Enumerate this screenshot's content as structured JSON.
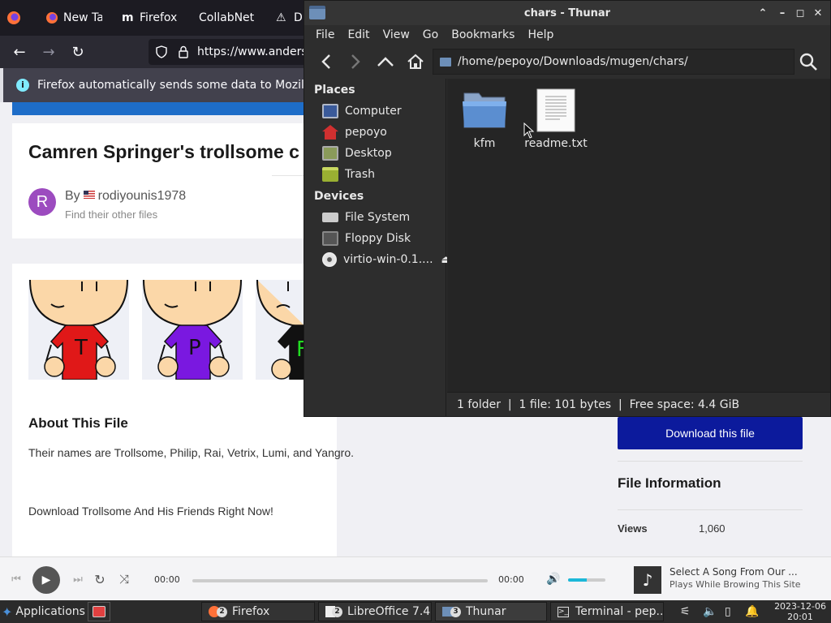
{
  "firefox": {
    "tabs": [
      {
        "label": "New Ta",
        "icon": "firefox-logo-icon"
      },
      {
        "label": "Firefox",
        "icon": "m-logo-icon"
      },
      {
        "label": "CollabNet",
        "icon": ""
      },
      {
        "label": "Di",
        "icon": "warning-icon"
      }
    ],
    "url": "https://www.anders",
    "infobar_text": "Firefox automatically sends some data to Mozilla",
    "page": {
      "title": "Camren Springer's trollsome c",
      "avatar_letter": "R",
      "by_label": "By",
      "author": "rodiyounis1978",
      "other_files": "Find their other files",
      "thumb_letters": [
        "T",
        "P",
        "F"
      ],
      "about_heading": "About This File",
      "about_p1": "Their names are Trollsome, Philip, Rai, Vetrix, Lumi, and Yangro.",
      "about_p2": "Download Trollsome And His Friends Right Now!",
      "download_button": "Download this file",
      "file_info_heading": "File Information",
      "views_label": "Views",
      "views_value": "1,060"
    },
    "player": {
      "time_current": "00:00",
      "time_total": "00:00",
      "volume_fraction": 0.5,
      "song_title": "Select A Song From Our ...",
      "song_subtitle": "Plays While Browing This Site"
    }
  },
  "thunar": {
    "title": "chars - Thunar",
    "menu": [
      "File",
      "Edit",
      "View",
      "Go",
      "Bookmarks",
      "Help"
    ],
    "path": "/home/pepoyo/Downloads/mugen/chars/",
    "places_heading": "Places",
    "places": [
      {
        "label": "Computer",
        "icon": "computer-icon"
      },
      {
        "label": "pepoyo",
        "icon": "home-icon"
      },
      {
        "label": "Desktop",
        "icon": "desktop-icon"
      },
      {
        "label": "Trash",
        "icon": "trash-icon"
      }
    ],
    "devices_heading": "Devices",
    "devices": [
      {
        "label": "File System",
        "icon": "drive-icon"
      },
      {
        "label": "Floppy Disk",
        "icon": "floppy-icon"
      },
      {
        "label": "virtio-win-0.1....",
        "icon": "cdrom-icon"
      }
    ],
    "files": [
      {
        "name": "kfm",
        "type": "folder"
      },
      {
        "name": "readme.txt",
        "type": "text"
      }
    ],
    "status": "1 folder  |  1 file: 101 bytes  |  Free space: 4.4 GiB"
  },
  "taskbar": {
    "applications": "Applications",
    "windows": [
      {
        "label": "Firefox",
        "count": "2"
      },
      {
        "label": "LibreOffice 7.4",
        "count": "2"
      },
      {
        "label": "Thunar",
        "count": "3"
      },
      {
        "label": "Terminal - pep...",
        "count": ""
      }
    ],
    "date": "2023-12-06",
    "time": "20:01"
  }
}
